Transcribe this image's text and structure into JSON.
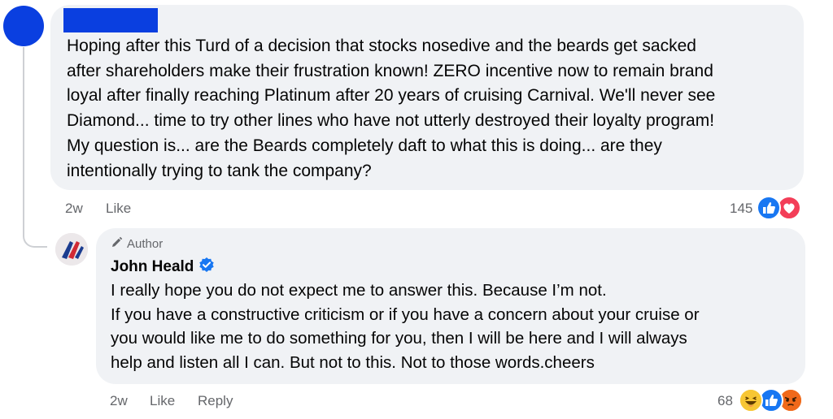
{
  "comment": {
    "text": "Hoping after this Turd of a decision that stocks nosedive and the beards get sacked\nafter shareholders make their frustration known! ZERO incentive now to remain brand\nloyal after finally reaching Platinum after 20 years of cruising Carnival. We'll never see\nDiamond... time to try other lines who have not utterly destroyed their loyalty program!\nMy question is... are the Beards completely daft to what this is doing... are they\nintentionally trying to tank the company?",
    "time": "2w",
    "like_label": "Like",
    "reaction_count": "145",
    "reactions": [
      "like-icon",
      "love-icon"
    ],
    "avatar_color": "#0a3fe0"
  },
  "reply": {
    "badge": "Author",
    "author": "John Heald",
    "verified": "verified-badge-icon",
    "text": "I really hope you do not expect me to answer this. Because I’m not.\nIf you have a constructive criticism or if you have a concern about your cruise or\nyou would like me to do something for you, then I will be here and I will always\nhelp and listen all I can. But not to this. Not to those words.cheers",
    "time": "2w",
    "like_label": "Like",
    "reply_label": "Reply",
    "reaction_count": "68",
    "reactions": [
      "haha-icon",
      "like-icon",
      "angry-icon"
    ]
  },
  "colors": {
    "bubble": "#f0f2f5",
    "meta": "#65676b",
    "facebook_blue": "#1877f2",
    "love_red": "#f33e58"
  }
}
